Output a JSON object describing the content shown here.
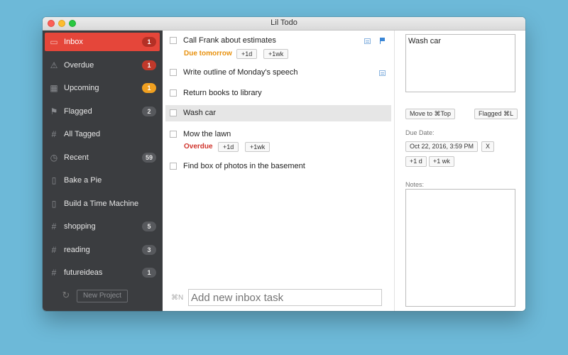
{
  "window": {
    "title": "Lil Todo"
  },
  "sidebar": {
    "items": [
      {
        "label": "Inbox",
        "icon": "inbox-icon",
        "badge": "1",
        "badge_style": "red"
      },
      {
        "label": "Overdue",
        "icon": "warning-icon",
        "badge": "1",
        "badge_style": "red"
      },
      {
        "label": "Upcoming",
        "icon": "calendar-icon",
        "badge": "1",
        "badge_style": "orange"
      },
      {
        "label": "Flagged",
        "icon": "flag-icon",
        "badge": "2",
        "badge_style": "gray"
      },
      {
        "label": "All Tagged",
        "icon": "hash-icon",
        "badge": "",
        "badge_style": ""
      },
      {
        "label": "Recent",
        "icon": "clock-icon",
        "badge": "59",
        "badge_style": "gray"
      },
      {
        "label": "Bake a Pie",
        "icon": "document-icon",
        "badge": "",
        "badge_style": ""
      },
      {
        "label": "Build a Time Machine",
        "icon": "document-icon",
        "badge": "",
        "badge_style": ""
      },
      {
        "label": "shopping",
        "icon": "hash-icon",
        "badge": "5",
        "badge_style": "gray"
      },
      {
        "label": "reading",
        "icon": "hash-icon",
        "badge": "3",
        "badge_style": "gray"
      },
      {
        "label": "futureideas",
        "icon": "hash-icon",
        "badge": "1",
        "badge_style": "gray"
      }
    ],
    "new_project_label": "New Project",
    "sync_icon": "sync-icon"
  },
  "tasks": {
    "items": [
      {
        "title": "Call Frank about estimates",
        "due_text": "Due tomorrow",
        "due_color": "#e8910e",
        "has_note": true,
        "flagged": true,
        "pill1": "+1d",
        "pill2": "+1wk"
      },
      {
        "title": "Write outline of Monday's speech",
        "has_note": true
      },
      {
        "title": "Return books to library"
      },
      {
        "title": "Wash car",
        "selected": true
      },
      {
        "title": "Mow the lawn",
        "due_text": "Overdue",
        "due_color": "#d0342c",
        "pill1": "+1d",
        "pill2": "+1wk"
      },
      {
        "title": "Find box of photos in the basement"
      }
    ],
    "shortcut": "⌘N",
    "add_placeholder": "Add new inbox task"
  },
  "detail": {
    "task_title": "Wash car",
    "move_to_top_label": "Move to ⌘Top",
    "flagged_label": "Flagged ⌘L",
    "due_date_label": "Due Date:",
    "due_date_value": "Oct 22, 2016, 3:59 PM",
    "clear_label": "X",
    "plus_day_label": "+1 d",
    "plus_week_label": "+1 wk",
    "notes_label": "Notes:"
  },
  "colors": {
    "accent": "#e5463a",
    "sidebar_bg": "#3b3d40",
    "due_orange": "#e8910e",
    "overdue_red": "#d0342c",
    "flag_blue": "#3a86d6",
    "desktop": "#6db9d8"
  }
}
